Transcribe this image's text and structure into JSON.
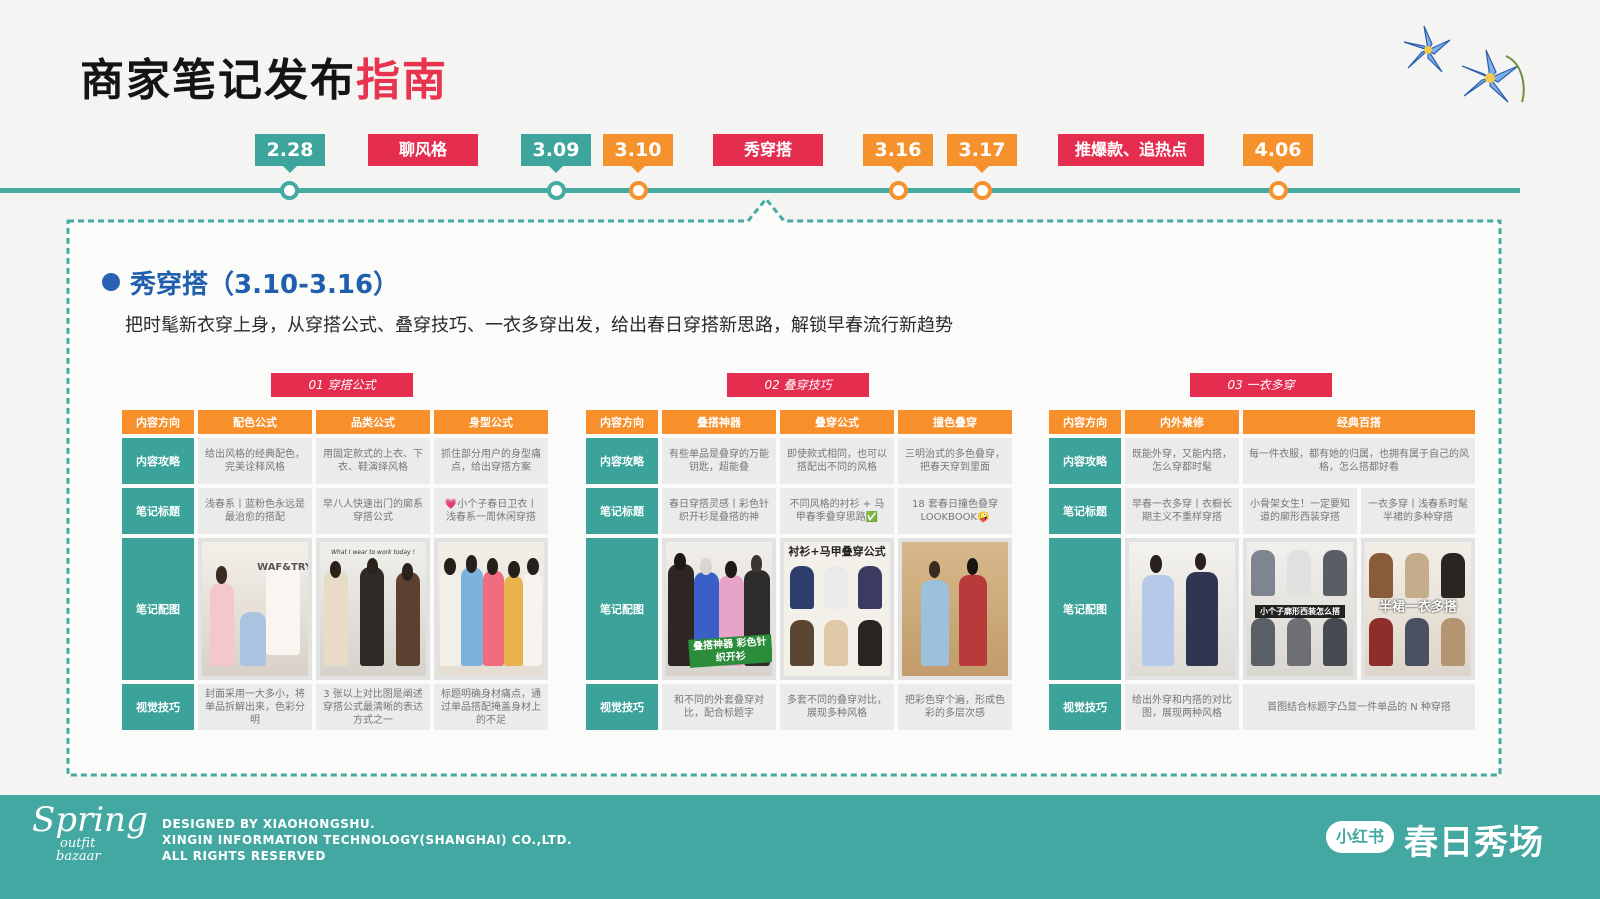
{
  "title": {
    "main": "商家笔记发布",
    "highlight": "指南"
  },
  "timeline": [
    {
      "label": "2.28",
      "style": "teal"
    },
    {
      "label": "聊风格",
      "style": "red"
    },
    {
      "label": "3.09",
      "style": "teal"
    },
    {
      "label": "3.10",
      "style": "orange"
    },
    {
      "label": "秀穿搭",
      "style": "red"
    },
    {
      "label": "3.16",
      "style": "orange"
    },
    {
      "label": "3.17",
      "style": "orange"
    },
    {
      "label": "推爆款、追热点",
      "style": "red"
    },
    {
      "label": "4.06",
      "style": "orange"
    }
  ],
  "section": {
    "heading": "秀穿搭（3.10-3.16）",
    "description": "把时髦新衣穿上身，从穿搭公式、叠穿技巧、一衣多穿出发，给出春日穿搭新思路，解锁早春流行新趋势"
  },
  "row_labels": [
    "内容方向",
    "内容攻略",
    "笔记标题",
    "笔记配图",
    "视觉技巧"
  ],
  "groups": [
    {
      "title": "01 穿搭公式",
      "columns": [
        {
          "header": "配色公式",
          "strategy": "给出风格的经典配色，完美诠释风格",
          "note_title": "浅春系丨蓝粉色永远是最治愈的搭配",
          "visual": "封面采用一大多小，将单品拆解出来，色彩分明"
        },
        {
          "header": "品类公式",
          "strategy": "用固定款式的上衣、下衣、鞋演绎风格",
          "note_title": "早八人快速出门的廓系穿搭公式",
          "visual": "3 张以上对比图是阐述穿搭公式最清晰的表达方式之一"
        },
        {
          "header": "身型公式",
          "strategy": "抓住部分用户的身型痛点，给出穿搭方案",
          "note_title": "💗小个子春日卫衣丨浅春系一周休闲穿搭",
          "visual": "标题明确身材痛点，通过单品搭配掩盖身材上的不足"
        }
      ]
    },
    {
      "title": "02 叠穿技巧",
      "columns": [
        {
          "header": "叠搭神器",
          "strategy": "有些单品是叠穿的万能钥匙，超能叠",
          "note_title": "春日穿搭灵感丨彩色针织开衫是叠搭的神",
          "visual": "和不同的外套叠穿对比，配合标题字"
        },
        {
          "header": "叠穿公式",
          "strategy": "即使款式相同，也可以搭配出不同的风格",
          "note_title": "不同风格的衬衫 + 马甲春季叠穿思路✅",
          "visual": "多套不同的叠穿对比，展现多种风格"
        },
        {
          "header": "撞色叠穿",
          "strategy": "三明治式的多色叠穿，把春天穿到里面",
          "note_title": "18 套春日撞色叠穿 LOOKBOOK🤪",
          "visual": "把彩色穿个遍，形成色彩的多层次感"
        }
      ]
    },
    {
      "title": "03 一衣多穿",
      "columns": [
        {
          "header": "内外兼修",
          "strategy": "既能外穿，又能内搭，怎么穿都时髦",
          "note_title": "早春一衣多穿丨衣橱长期主义不重样穿搭",
          "visual": "给出外穿和内搭的对比图，展现两种风格"
        },
        {
          "header": "经典百搭",
          "strategy": "每一件衣服，都有她的归属，也拥有属于自己的风格，怎么搭都好看",
          "note_titles": [
            "小骨架女生！一定要知道的廓形西装穿搭",
            "一衣多穿丨浅春系时髦半裙的多种穿搭"
          ],
          "visual": "首图结合标题字凸显一件单品的 N 种穿搭"
        }
      ]
    }
  ],
  "photo_captions": {
    "g1c1": "WAF&TRY",
    "g1c2": "What I wear to work today !",
    "g2c1": "叠搭神器 彩色针织开衫",
    "g2c2": "衬衫+马甲叠穿公式",
    "g3c2": "小个子廓形西装怎么搭",
    "g3c3": "半裙一衣多搭"
  },
  "footer": {
    "brand": [
      "Spring",
      "outfit",
      "bazaar"
    ],
    "legal": [
      "DESIGNED BY XIAOHONGSHU.",
      "XINGIN INFORMATION TECHNOLOGY(SHANGHAI) CO.,LTD.",
      "ALL RIGHTS RESERVED"
    ],
    "logo": "小红书",
    "campaign": "春日秀场"
  },
  "colors": {
    "teal": "#43a8a1",
    "orange": "#f6922e",
    "red": "#e52d50",
    "blue": "#1f5fae"
  }
}
